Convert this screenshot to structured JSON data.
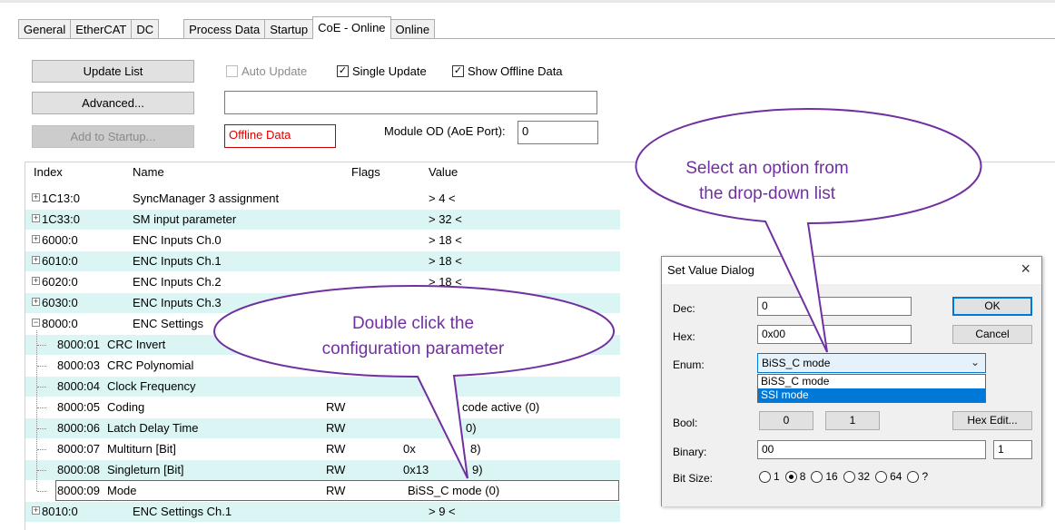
{
  "tabs": [
    "General",
    "EtherCAT",
    "DC",
    "Process Data",
    "Startup",
    "CoE - Online",
    "Online"
  ],
  "toolbar": {
    "update_list": "Update List",
    "auto_update": "Auto Update",
    "single_update": "Single Update",
    "show_offline": "Show Offline Data",
    "advanced": "Advanced...",
    "add_to_startup": "Add to Startup...",
    "offline_data": "Offline Data",
    "module_od_label": "Module OD (AoE Port):",
    "module_od_value": "0"
  },
  "columns": {
    "index": "Index",
    "name": "Name",
    "flags": "Flags",
    "value": "Value"
  },
  "rows": [
    {
      "index": "1C13:0",
      "name": "SyncManager 3 assignment",
      "flags": "",
      "value": "> 4 <"
    },
    {
      "index": "1C33:0",
      "name": "SM input parameter",
      "flags": "",
      "value": "> 32 <"
    },
    {
      "index": "6000:0",
      "name": "ENC Inputs Ch.0",
      "flags": "",
      "value": "> 18 <"
    },
    {
      "index": "6010:0",
      "name": "ENC Inputs Ch.1",
      "flags": "",
      "value": "> 18 <"
    },
    {
      "index": "6020:0",
      "name": "ENC Inputs Ch.2",
      "flags": "",
      "value": "> 18 <"
    },
    {
      "index": "6030:0",
      "name": "ENC Inputs Ch.3",
      "flags": "",
      "value": ""
    },
    {
      "index": "8000:0",
      "name": "ENC Settings",
      "flags": "",
      "value": ""
    },
    {
      "index": "8000:01",
      "name": "CRC Invert",
      "flags": "",
      "value": ""
    },
    {
      "index": "8000:03",
      "name": "CRC Polynomial",
      "flags": "",
      "value": ""
    },
    {
      "index": "8000:04",
      "name": "Clock Frequency",
      "flags": "",
      "value": ""
    },
    {
      "index": "8000:05",
      "name": "Coding",
      "flags": "RW",
      "value": "code active (0)"
    },
    {
      "index": "8000:06",
      "name": "Latch Delay Time",
      "flags": "RW",
      "value": "0)"
    },
    {
      "index": "8000:07",
      "name": "Multiturn [Bit]",
      "flags": "RW",
      "value": "0x"
    },
    {
      "index": "8000:08",
      "name": "Singleturn [Bit]",
      "flags": "RW",
      "value": "0x13"
    },
    {
      "index": "8000:09",
      "name": "Mode",
      "flags": "RW",
      "value": "BiSS_C mode (0)"
    },
    {
      "index": "8010:0",
      "name": "ENC Settings Ch.1",
      "flags": "",
      "value": "> 9 <"
    }
  ],
  "value_fragments": {
    "r12": "8)",
    "r13": "9)"
  },
  "dialog": {
    "title": "Set Value Dialog",
    "close": "×",
    "dec_label": "Dec:",
    "dec_value": "0",
    "hex_label": "Hex:",
    "hex_value": "0x00",
    "enum_label": "Enum:",
    "enum_value": "BiSS_C mode",
    "enum_options": [
      "BiSS_C mode",
      "SSI mode"
    ],
    "bool_label": "Bool:",
    "bool_0": "0",
    "bool_1": "1",
    "hex_edit": "Hex Edit...",
    "binary_label": "Binary:",
    "binary_value": "00",
    "binary_count": "1",
    "bitsize_label": "Bit Size:",
    "bitsizes": [
      "1",
      "8",
      "16",
      "32",
      "64",
      "?"
    ],
    "bitsize_selected": "8",
    "ok": "OK",
    "cancel": "Cancel"
  },
  "callouts": {
    "top_line1": "Select an option from",
    "top_line2": "the drop-down list",
    "mid_line1": "Double click the",
    "mid_line2": "configuration parameter"
  },
  "colors": {
    "callout": "#7030a0",
    "alt_row": "#dbf5f5",
    "selection": "#0078d7"
  }
}
